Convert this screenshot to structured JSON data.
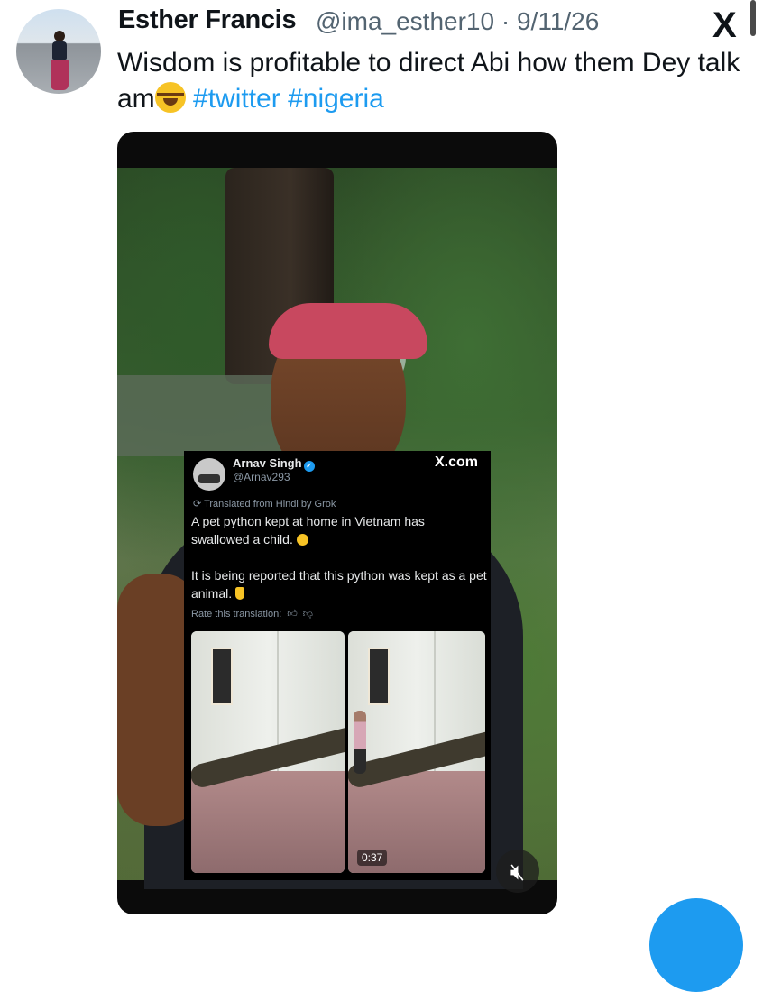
{
  "tweet": {
    "author_name": "Esther Francis",
    "author_handle": "@ima_esther10",
    "separator": " · ",
    "date": "9/11/26",
    "text": "Wisdom is profitable to direct Abi how them Dey talk am",
    "hashtags": [
      "#twitter",
      "#nigeria"
    ]
  },
  "embedded_post": {
    "name": "Arnav Singh",
    "handle": "@Arnav293",
    "site": "X.com",
    "translated_label": "Translated from Hindi by Grok",
    "text_1": "A pet python kept at home in Vietnam has swallowed a child.",
    "text_2": "It is being reported that this python was kept as a pet animal.",
    "rate_label": "Rate this translation:",
    "video_duration": "0:37"
  },
  "icons": {
    "close": "X",
    "mute": "muted-speaker-icon"
  },
  "colors": {
    "link": "#1d9bf0",
    "secondary_text": "#536471",
    "media_bg": "#0b0b0b"
  }
}
